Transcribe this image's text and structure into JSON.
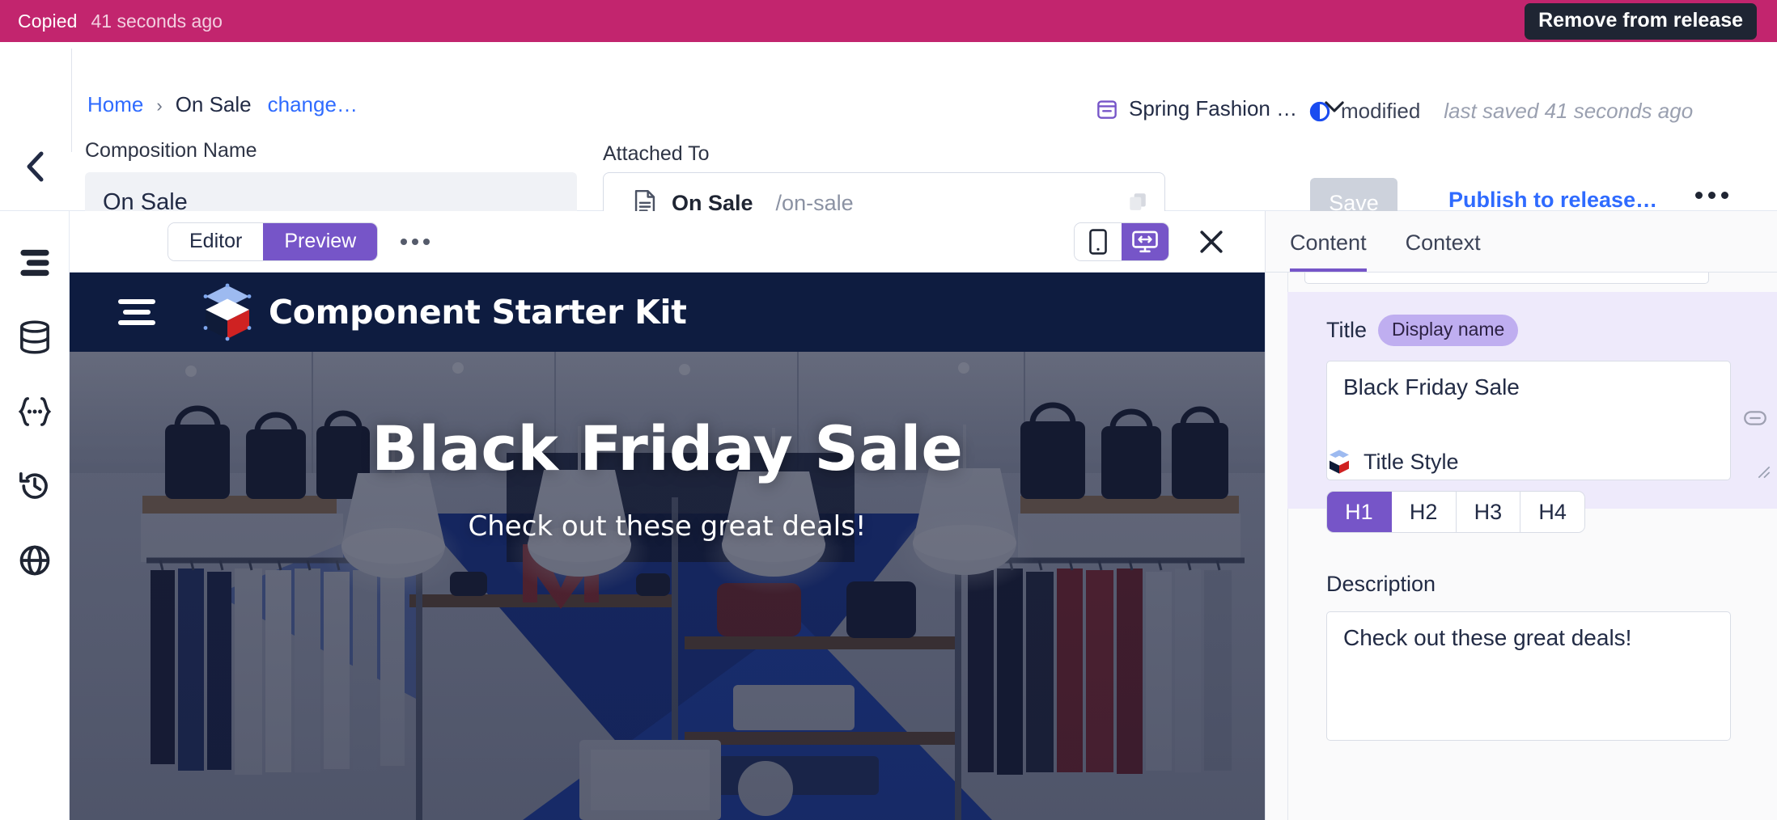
{
  "notification": {
    "title": "Copied",
    "time": "41 seconds ago",
    "action_label": "Remove from release"
  },
  "header": {
    "breadcrumb": {
      "home": "Home",
      "separator": "›",
      "current": "On Sale",
      "change_link": "change…"
    },
    "composition_name_label": "Composition Name",
    "composition_name_value": "On Sale",
    "attached_to_label": "Attached To",
    "attached_to_name": "On Sale",
    "attached_to_slug": "/on-sale",
    "release_name": "Spring Fashion …",
    "status": "modified",
    "last_saved": "last saved 41 seconds ago",
    "save_label": "Save",
    "publish_label": "Publish to release…"
  },
  "rail": {
    "items": [
      {
        "name": "compositions-icon"
      },
      {
        "name": "data-sources-icon"
      },
      {
        "name": "code-snippet-icon"
      },
      {
        "name": "history-icon"
      },
      {
        "name": "globe-icon"
      }
    ]
  },
  "preview_toolbar": {
    "editor_label": "Editor",
    "preview_label": "Preview",
    "active_mode": "Preview",
    "device_mobile": "mobile-device-icon",
    "device_desktop": "responsive-desktop-icon",
    "active_device": "responsive-desktop-icon"
  },
  "preview": {
    "brand": "Component Starter Kit",
    "hero_title": "Black Friday Sale",
    "hero_subtitle": "Check out these great deals!"
  },
  "right_panel": {
    "tabs": [
      {
        "label": "Content",
        "active": true
      },
      {
        "label": "Context",
        "active": false
      }
    ],
    "title_field": {
      "label": "Title",
      "badge": "Display name",
      "value": "Black Friday Sale"
    },
    "title_style": {
      "label": "Title Style",
      "options": [
        "H1",
        "H2",
        "H3",
        "H4"
      ],
      "selected": "H1"
    },
    "description_field": {
      "label": "Description",
      "value": "Check out these great deals!"
    }
  },
  "colors": {
    "notification_bg": "#c2256e",
    "accent_purple": "#7655c8",
    "link_blue": "#2f6bff",
    "dark_navy": "#0e1c40",
    "badge_purple": "#bfaef0"
  }
}
